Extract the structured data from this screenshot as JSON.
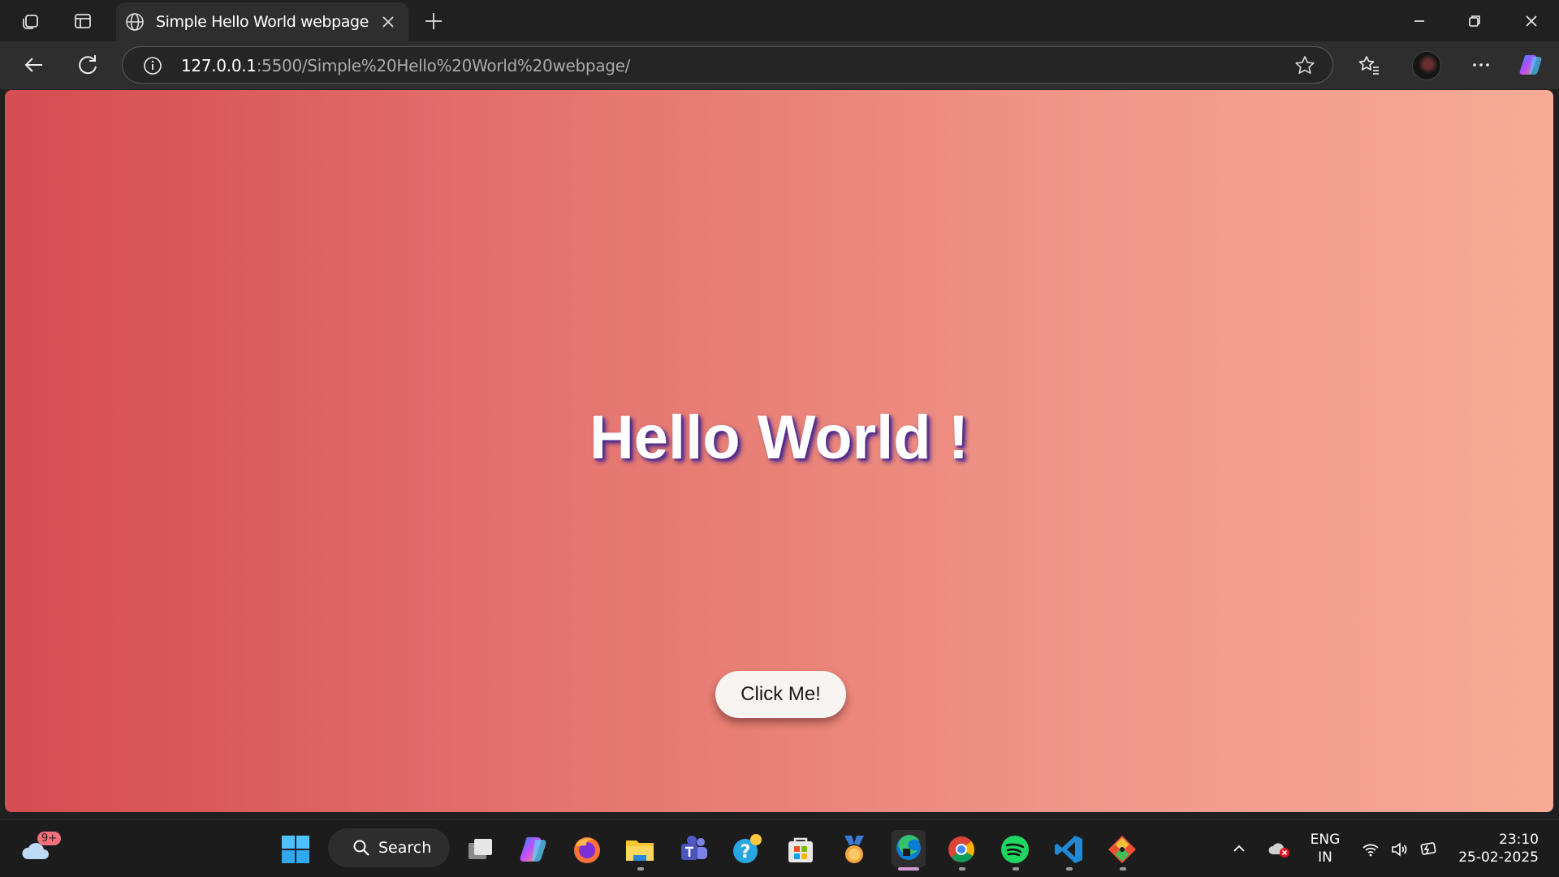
{
  "browser": {
    "tab_title": "Simple Hello World webpage",
    "url_host": "127.0.0.1",
    "url_rest": ":5500/Simple%20Hello%20World%20webpage/"
  },
  "page": {
    "heading": "Hello World !",
    "button_label": "Click Me!",
    "colors": {
      "gradient_start": "#d64d53",
      "gradient_end": "#f8ab95",
      "heading_shadow": "#4d2a8a"
    }
  },
  "taskbar": {
    "weather_badge": "9+",
    "search_label": "Search",
    "language_line1": "ENG",
    "language_line2": "IN",
    "time": "23:10",
    "date": "25-02-2025",
    "apps": [
      "windows-start",
      "task-view",
      "copilot",
      "firefox",
      "file-explorer",
      "teams",
      "get-help",
      "microsoft-store",
      "rewards",
      "edge",
      "chrome",
      "spotify",
      "vscode",
      "git"
    ]
  }
}
